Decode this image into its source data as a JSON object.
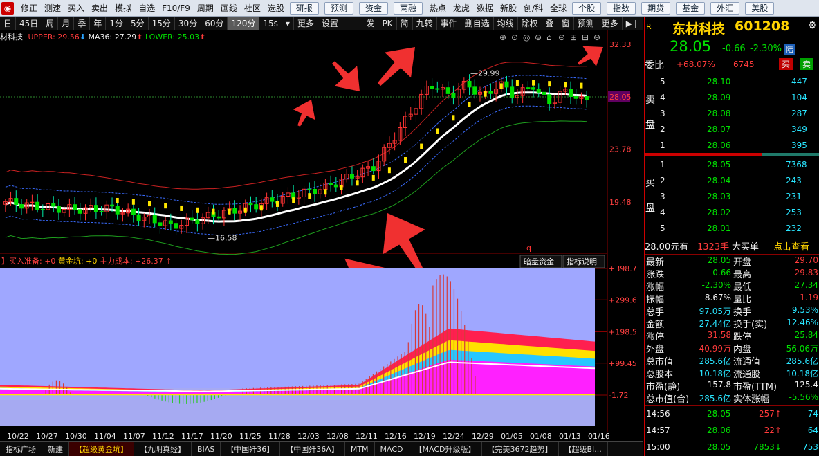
{
  "menu": {
    "items": [
      "修正",
      "测速",
      "买入",
      "卖出",
      "模拟",
      "自选",
      "F10/F9",
      "周期",
      "画线",
      "社区",
      "选股"
    ],
    "buttons": [
      "研报",
      "预测",
      "资金",
      "两融"
    ],
    "items2": [
      "热点",
      "龙虎",
      "数据",
      "新股",
      "创/科"
    ],
    "items3": [
      "全球"
    ],
    "buttons2": [
      "个股",
      "指数",
      "期货",
      "基金",
      "外汇",
      "美股"
    ]
  },
  "toolbar": {
    "items": [
      "日",
      "45日",
      "周",
      "月",
      "季",
      "年",
      "1分",
      "5分",
      "15分",
      "30分",
      "60分",
      "120分",
      "15s",
      "▾",
      "更多",
      "设置"
    ],
    "active": "120分",
    "right": [
      "发",
      "PK",
      "简",
      "九转",
      "事件",
      "删自选",
      "均线",
      "除权",
      "叠",
      "窗",
      "预测",
      "更多"
    ]
  },
  "legend": {
    "name": "材科技",
    "upper": "UPPER: 29.56",
    "ma": "MA36: 27.29",
    "lower": "LOWER: 25.03"
  },
  "price_axis": [
    "32.33",
    "28.05",
    "23.78",
    "19.48"
  ],
  "annotations": {
    "high": "29.99",
    "low": "16.58",
    "q": "q"
  },
  "indicator": {
    "title": "】买入准备: +0",
    "gold": "黄金坑: +0",
    "cost": "主力成本: +26.37",
    "btn1": "暗盘资金",
    "btn2": "指标说明",
    "axis": [
      "+398.7",
      "+299.6",
      "+198.5",
      "+99.45",
      "-1.72"
    ]
  },
  "dates": [
    "10/22",
    "10/27",
    "10/30",
    "11/04",
    "11/07",
    "11/12",
    "11/17",
    "11/20",
    "11/25",
    "11/28",
    "12/03",
    "12/08",
    "12/11",
    "12/16",
    "12/19",
    "12/24",
    "12/29",
    "01/05",
    "01/08",
    "01/13",
    "01/16"
  ],
  "bottom_tabs": [
    "指标广场",
    "新建",
    "【超级黄金坑】",
    "【九阴真经】",
    "BIAS",
    "【中国歼36】",
    "【中国歼36A】",
    "MTM",
    "MACD",
    "【MACD升级版】",
    "【完美3672趋势】",
    "【超级BI..."
  ],
  "bottom_active": "【超级黄金坑】",
  "stock": {
    "r": "R",
    "name": "东材科技",
    "code": "601208",
    "price": "28.05",
    "change": "-0.66",
    "pct": "-2.30%",
    "tag": "陆"
  },
  "weibi": {
    "label": "委比",
    "pct": "+68.07%",
    "val": "6745",
    "buy": "买",
    "sell": "卖"
  },
  "sell_label": [
    "卖",
    "盘"
  ],
  "buy_label": [
    "买",
    "盘"
  ],
  "asks": [
    {
      "lvl": "5",
      "p": "28.10",
      "v": "447"
    },
    {
      "lvl": "4",
      "p": "28.09",
      "v": "104"
    },
    {
      "lvl": "3",
      "p": "28.08",
      "v": "287"
    },
    {
      "lvl": "2",
      "p": "28.07",
      "v": "349"
    },
    {
      "lvl": "1",
      "p": "28.06",
      "v": "395"
    }
  ],
  "bids": [
    {
      "lvl": "1",
      "p": "28.05",
      "v": "7368"
    },
    {
      "lvl": "2",
      "p": "28.04",
      "v": "243"
    },
    {
      "lvl": "3",
      "p": "28.03",
      "v": "231"
    },
    {
      "lvl": "4",
      "p": "28.02",
      "v": "253"
    },
    {
      "lvl": "5",
      "p": "28.01",
      "v": "232"
    }
  ],
  "bigorder": {
    "price": "28.00元有",
    "qty": "1323手",
    "label": "大买单",
    "link": "点击查看"
  },
  "stats": [
    {
      "k1": "最新",
      "v1": "28.05",
      "c1": "grn",
      "k2": "开盘",
      "v2": "29.70",
      "c2": "red"
    },
    {
      "k1": "涨跌",
      "v1": "-0.66",
      "c1": "grn",
      "k2": "最高",
      "v2": "29.83",
      "c2": "red"
    },
    {
      "k1": "涨幅",
      "v1": "-2.30%",
      "c1": "grn",
      "k2": "最低",
      "v2": "27.34",
      "c2": "grn"
    },
    {
      "k1": "振幅",
      "v1": "8.67%",
      "c1": "wht",
      "k2": "量比",
      "v2": "1.19",
      "c2": "red"
    },
    {
      "k1": "总手",
      "v1": "97.05万",
      "c1": "cyn",
      "k2": "换手",
      "v2": "9.53%",
      "c2": "cyn"
    },
    {
      "k1": "金额",
      "v1": "27.44亿",
      "c1": "cyn",
      "k2": "换手(实)",
      "v2": "12.46%",
      "c2": "cyn"
    },
    {
      "k1": "涨停",
      "v1": "31.58",
      "c1": "red",
      "k2": "跌停",
      "v2": "25.84",
      "c2": "grn"
    },
    {
      "k1": "外盘",
      "v1": "40.99万",
      "c1": "red",
      "k2": "内盘",
      "v2": "56.06万",
      "c2": "grn"
    },
    {
      "k1": "总市值",
      "v1": "285.6亿",
      "c1": "cyn",
      "k2": "流通值",
      "v2": "285.6亿",
      "c2": "cyn"
    },
    {
      "k1": "总股本",
      "v1": "10.18亿",
      "c1": "cyn",
      "k2": "流通股",
      "v2": "10.18亿",
      "c2": "cyn"
    },
    {
      "k1": "市盈(静)",
      "v1": "157.8",
      "c1": "wht",
      "k2": "市盈(TTM)",
      "v2": "125.4",
      "c2": "wht"
    },
    {
      "k1": "总市值(合)",
      "v1": "285.6亿",
      "c1": "cyn",
      "k2": "实体涨幅",
      "v2": "-5.56%",
      "c2": "grn"
    }
  ],
  "ticks": [
    {
      "t": "14:56",
      "p": "28.05",
      "v": "257",
      "arrow": "↑",
      "n": "74"
    },
    {
      "t": "14:57",
      "p": "28.06",
      "v": "22",
      "arrow": "↑",
      "n": "64"
    },
    {
      "t": "15:00",
      "p": "28.05",
      "v": "7853",
      "arrow": "↓",
      "n": "753"
    }
  ],
  "chart_data": {
    "type": "candlestick",
    "period": "120分",
    "upper": 29.56,
    "ma36": 27.29,
    "lower": 25.03,
    "last": 28.05,
    "marked_high": 29.99,
    "marked_low": 16.58,
    "y_ticks": [
      32.33,
      28.05,
      23.78,
      19.48
    ],
    "indicator_y_ticks": [
      398.7,
      299.6,
      198.5,
      99.45,
      -1.72
    ]
  }
}
